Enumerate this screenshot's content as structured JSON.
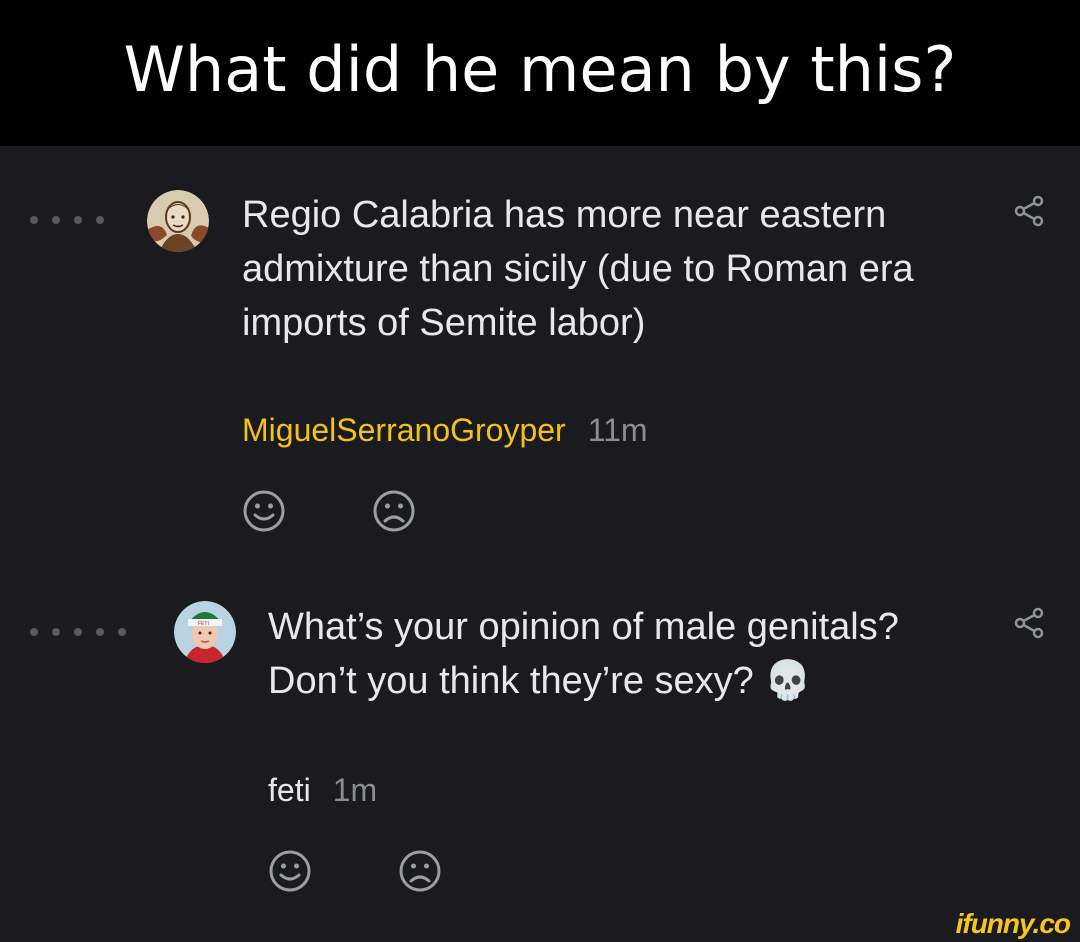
{
  "caption": "What did he mean by this?",
  "comments": [
    {
      "text": "Regio Calabria has more near eastern admixture than sicily (due to Roman era imports of Semite labor)",
      "username": "MiguelSerranoGroyper",
      "time": "11m",
      "thread_depth": 4,
      "username_color": "#f2c21b",
      "avatar_icon": "sepia-portrait-avatar"
    },
    {
      "text": "What’s your opinion of male genitals? Don’t you think they’re sexy? 💀",
      "username": "feti",
      "time": "1m",
      "thread_depth": 5,
      "username_color": "#e8e8ea",
      "avatar_icon": "person-in-santa-hat-avatar"
    }
  ],
  "icons": {
    "share": "share-icon",
    "smile": "smile-icon",
    "frown": "frown-icon",
    "skull": "skull-emoji"
  },
  "colors": {
    "background": "#1b1b1f",
    "caption_bar": "#000000",
    "accent_username": "#f2c21b",
    "watermark": "#f7c61e"
  },
  "watermark": "ifunny.co"
}
